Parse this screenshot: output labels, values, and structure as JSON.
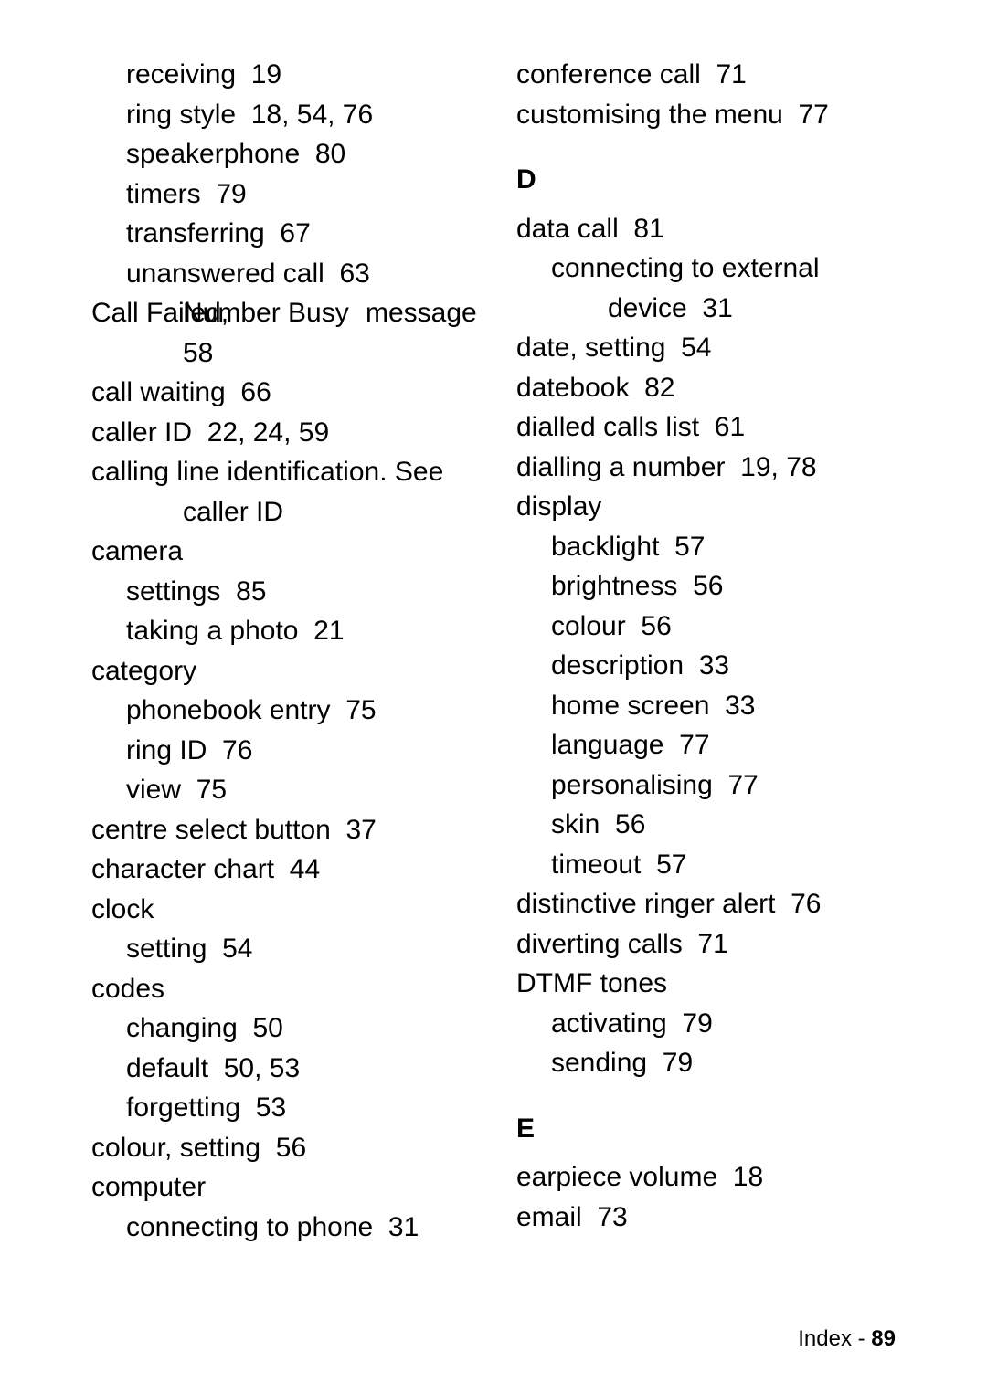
{
  "left": {
    "e1": {
      "text": "receiving",
      "pages": "19"
    },
    "e2": {
      "text": "ring style",
      "pages": "18, 54, 76"
    },
    "e3": {
      "text": "speakerphone",
      "pages": "80"
    },
    "e4": {
      "text": "timers",
      "pages": "79"
    },
    "e5": {
      "text": "transferring",
      "pages": "67"
    },
    "e6": {
      "text": "unanswered call",
      "pages": "63"
    },
    "overA": "Call Failed,",
    "overB": "Number Busy",
    "overC": "message",
    "e7p": "58",
    "e8": {
      "text": "call waiting",
      "pages": "66"
    },
    "e9": {
      "text": "caller ID",
      "pages": "22, 24, 59"
    },
    "e10a": "calling line identification. ",
    "e10b": "See",
    "e10c": "caller ID",
    "e11": "camera",
    "e12": {
      "text": "settings",
      "pages": "85"
    },
    "e13": {
      "text": "taking a photo",
      "pages": "21"
    },
    "e14": "category",
    "e15": {
      "text": "phonebook entry",
      "pages": "75"
    },
    "e16": {
      "text": "ring ID",
      "pages": "76"
    },
    "e17": {
      "text": "view",
      "pages": "75"
    },
    "e18": {
      "text": "centre select button",
      "pages": "37"
    },
    "e19": {
      "text": "character chart",
      "pages": "44"
    },
    "e20": "clock",
    "e21": {
      "text": "setting",
      "pages": "54"
    },
    "e22": "codes",
    "e23": {
      "text": "changing",
      "pages": "50"
    },
    "e24": {
      "text": "default",
      "pages": "50, 53"
    },
    "e25": {
      "text": "forgetting",
      "pages": "53"
    },
    "e26": {
      "text": "colour, setting",
      "pages": "56"
    },
    "e27": "computer",
    "e28": {
      "text": "connecting to phone",
      "pages": "31"
    }
  },
  "right": {
    "e1": {
      "text": "conference call",
      "pages": "71"
    },
    "e2": {
      "text": "customising the menu",
      "pages": "77"
    },
    "hD": "D",
    "e3": {
      "text": "data call",
      "pages": "81"
    },
    "e4a": "connecting to external",
    "e4b": {
      "text": "device",
      "pages": "31"
    },
    "e5": {
      "text": "date, setting",
      "pages": "54"
    },
    "e6": {
      "text": "datebook",
      "pages": "82"
    },
    "e7": {
      "text": "dialled calls list",
      "pages": "61"
    },
    "e8": {
      "text": "dialling a number",
      "pages": "19, 78"
    },
    "e9": "display",
    "e10": {
      "text": "backlight",
      "pages": "57"
    },
    "e11": {
      "text": "brightness",
      "pages": "56"
    },
    "e12": {
      "text": "colour",
      "pages": "56"
    },
    "e13": {
      "text": "description",
      "pages": "33"
    },
    "e14": {
      "text": "home screen",
      "pages": "33"
    },
    "e15": {
      "text": "language",
      "pages": "77"
    },
    "e16": {
      "text": "personalising",
      "pages": "77"
    },
    "e17": {
      "text": "skin",
      "pages": "56"
    },
    "e18": {
      "text": "timeout",
      "pages": "57"
    },
    "e19": {
      "text": "distinctive ringer alert",
      "pages": "76"
    },
    "e20": {
      "text": "diverting calls",
      "pages": "71"
    },
    "e21": "DTMF tones",
    "e22": {
      "text": "activating",
      "pages": "79"
    },
    "e23": {
      "text": "sending",
      "pages": "79"
    },
    "hE": "E",
    "e24": {
      "text": "earpiece volume",
      "pages": "18"
    },
    "e25": {
      "text": "email",
      "pages": "73"
    }
  },
  "footer": {
    "label": "Index - ",
    "page": "89"
  }
}
